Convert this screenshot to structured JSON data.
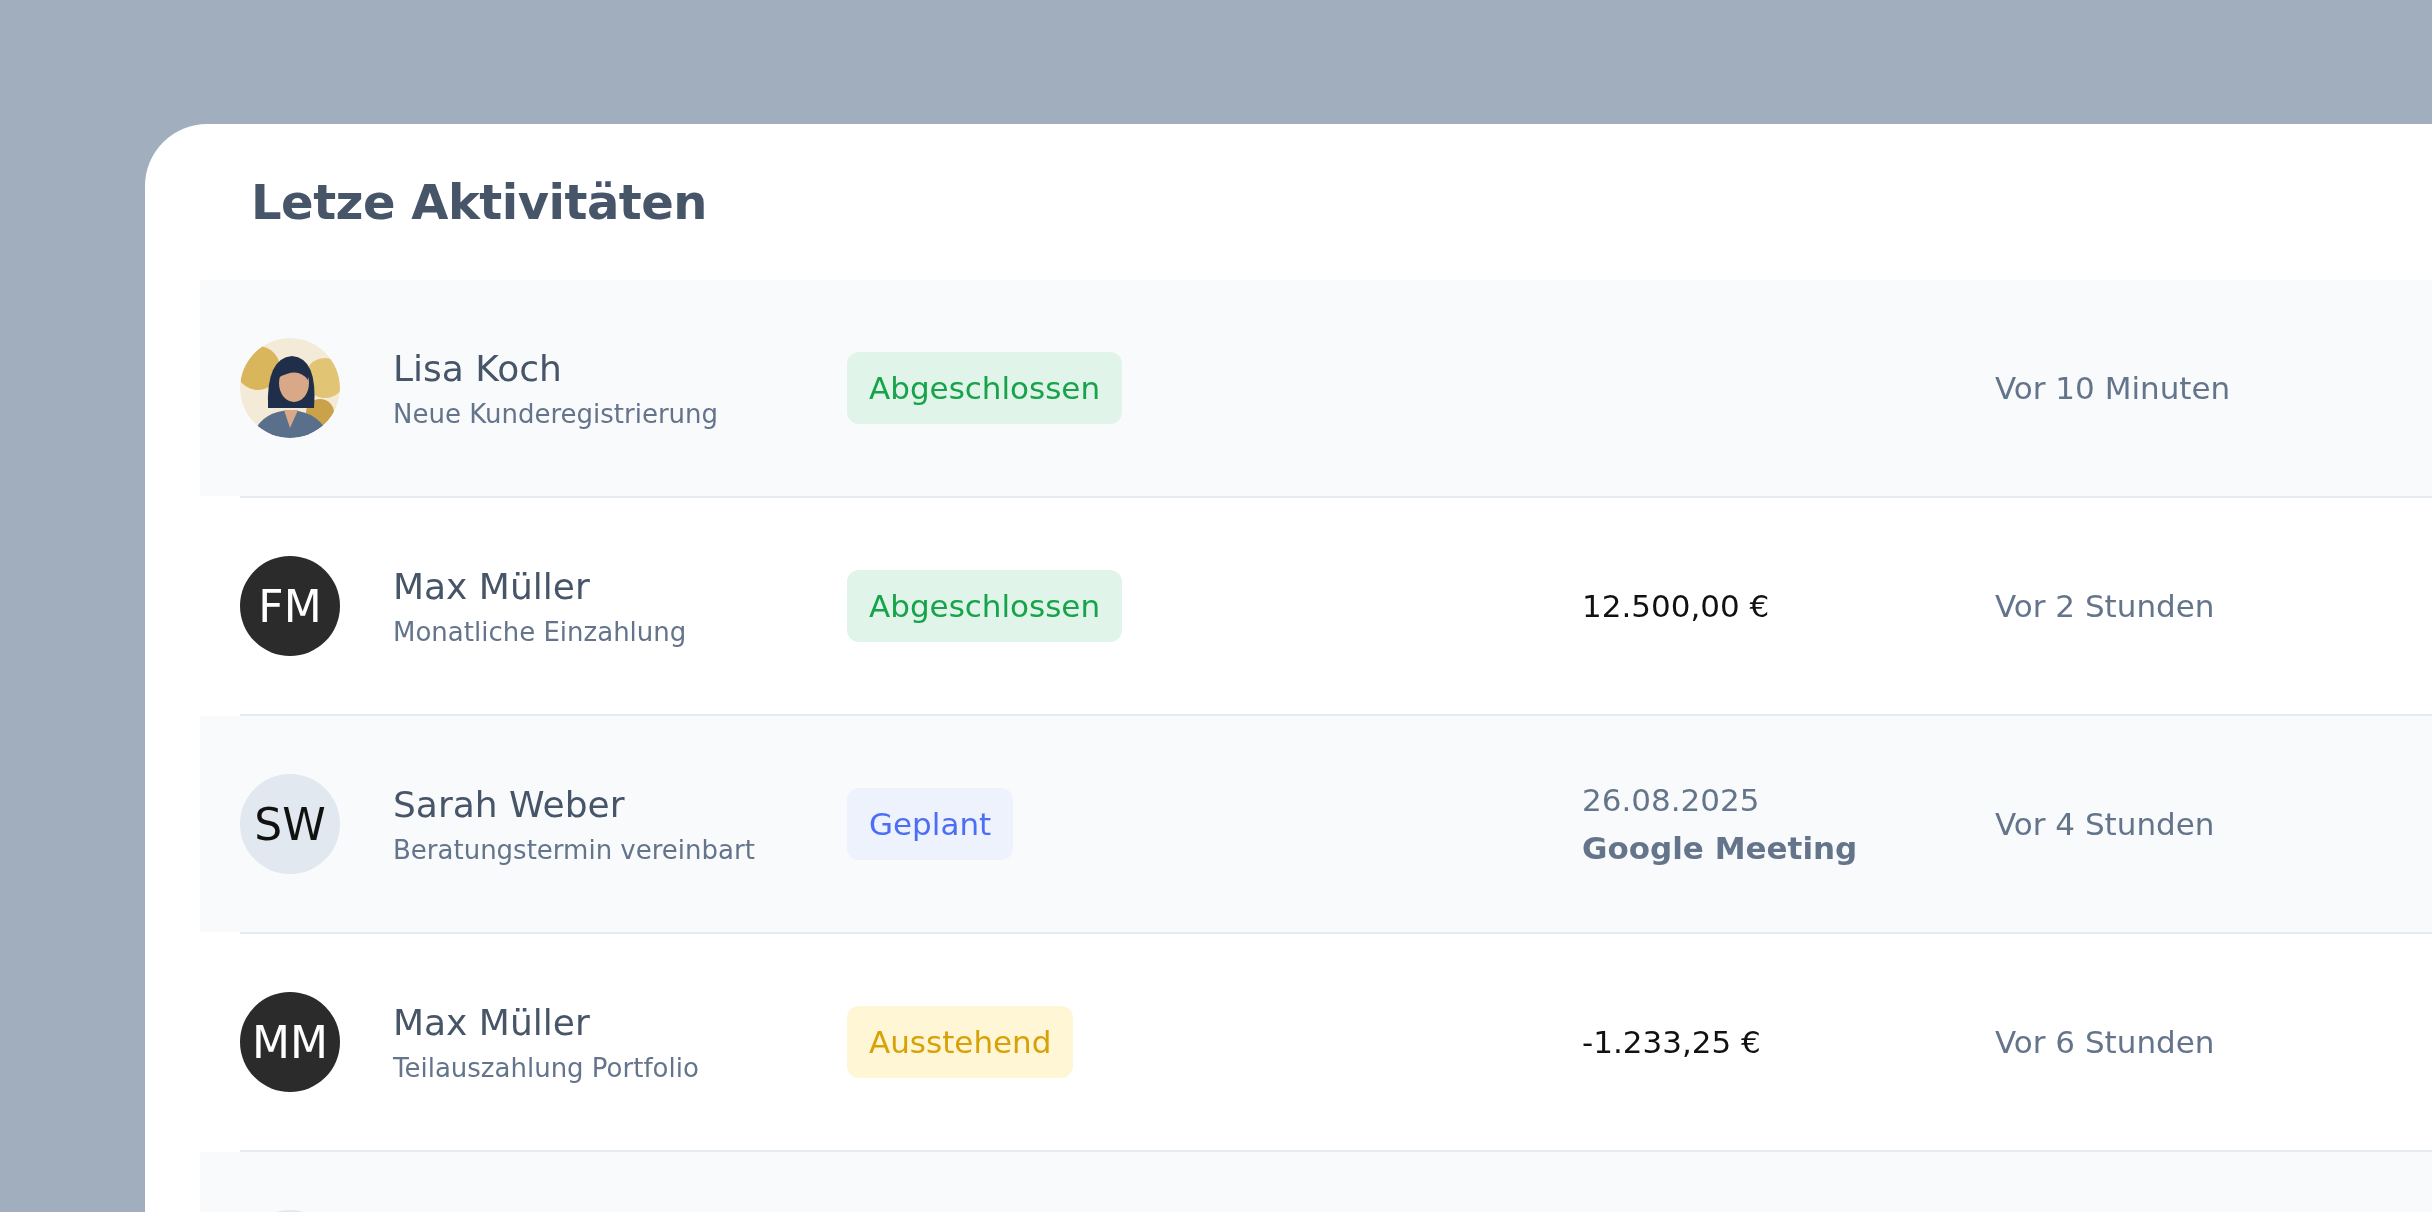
{
  "title": "Letze Aktivitäten",
  "activities": [
    {
      "name": "Lisa Koch",
      "description": "Neue Kunderegistrierung",
      "status": {
        "label": "Abgeschlossen",
        "kind": "done"
      },
      "time": "Vor 10 Minuten"
    },
    {
      "avatar": {
        "kind": "initials",
        "initials": "FM",
        "color": "#2b2b2b"
      },
      "name": "Max Müller",
      "description": "Monatliche Einzahlung",
      "status": {
        "label": "Abgeschlossen",
        "kind": "done"
      },
      "amount": "12.500,00 €",
      "time": "Vor 2 Stunden"
    },
    {
      "avatar": {
        "kind": "initials",
        "initials": "SW",
        "color": "#e2e8f0"
      },
      "name": "Sarah Weber",
      "description": "Beratungstermin vereinbart",
      "status": {
        "label": "Geplant",
        "kind": "planned"
      },
      "appointment": {
        "date": "26.08.2025",
        "place": "Google Meeting"
      },
      "time": "Vor 4 Stunden"
    },
    {
      "avatar": {
        "kind": "initials",
        "initials": "MM",
        "color": "#2b2b2b"
      },
      "name": "Max Müller",
      "description": "Teilauszahlung Portfolio",
      "status": {
        "label": "Ausstehend",
        "kind": "pending"
      },
      "amount": "-1.233,25 €",
      "time": "Vor 6 Stunden"
    }
  ]
}
